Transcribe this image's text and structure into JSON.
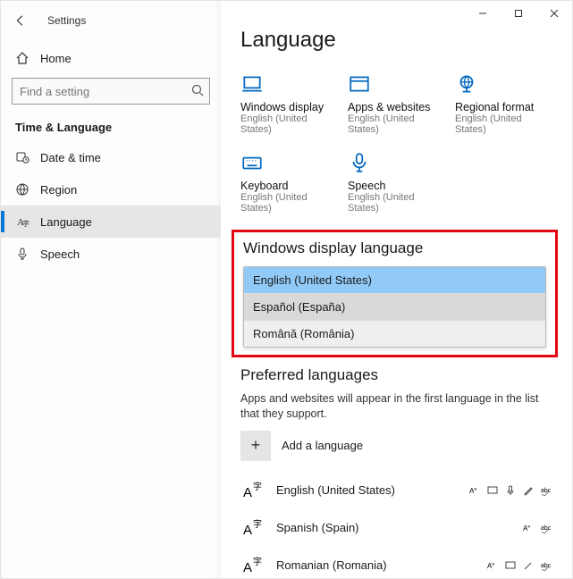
{
  "window": {
    "title": "Settings"
  },
  "sidebar": {
    "home": "Home",
    "search_placeholder": "Find a setting",
    "category": "Time & Language",
    "items": [
      {
        "label": "Date & time",
        "icon": "clock-date-icon"
      },
      {
        "label": "Region",
        "icon": "globe-icon"
      },
      {
        "label": "Language",
        "icon": "language-a-icon"
      },
      {
        "label": "Speech",
        "icon": "microphone-icon"
      }
    ],
    "active_index": 2
  },
  "main": {
    "title": "Language",
    "tiles": [
      {
        "label": "Windows display",
        "sub": "English (United States)",
        "icon": "laptop-icon"
      },
      {
        "label": "Apps & websites",
        "sub": "English (United States)",
        "icon": "window-icon"
      },
      {
        "label": "Regional format",
        "sub": "English (United States)",
        "icon": "globe-stand-icon"
      },
      {
        "label": "Keyboard",
        "sub": "English (United States)",
        "icon": "keyboard-icon"
      },
      {
        "label": "Speech",
        "sub": "English (United States)",
        "icon": "microphone-icon"
      }
    ],
    "display_language": {
      "heading": "Windows display language",
      "options": [
        {
          "label": "English (United States)",
          "selected": true
        },
        {
          "label": "Español (España)",
          "selected": false
        },
        {
          "label": "Română (România)",
          "selected": false
        }
      ]
    },
    "preferred": {
      "heading": "Preferred languages",
      "help": "Apps and websites will appear in the first language in the list that they support.",
      "add_label": "Add a language",
      "items": [
        {
          "label": "English (United States)",
          "features": [
            "tts",
            "display",
            "voice",
            "handwriting",
            "spell"
          ]
        },
        {
          "label": "Spanish (Spain)",
          "features": [
            "tts",
            "spell"
          ]
        },
        {
          "label": "Romanian (Romania)",
          "features": [
            "tts",
            "display",
            "voice",
            "spell"
          ]
        }
      ]
    }
  }
}
